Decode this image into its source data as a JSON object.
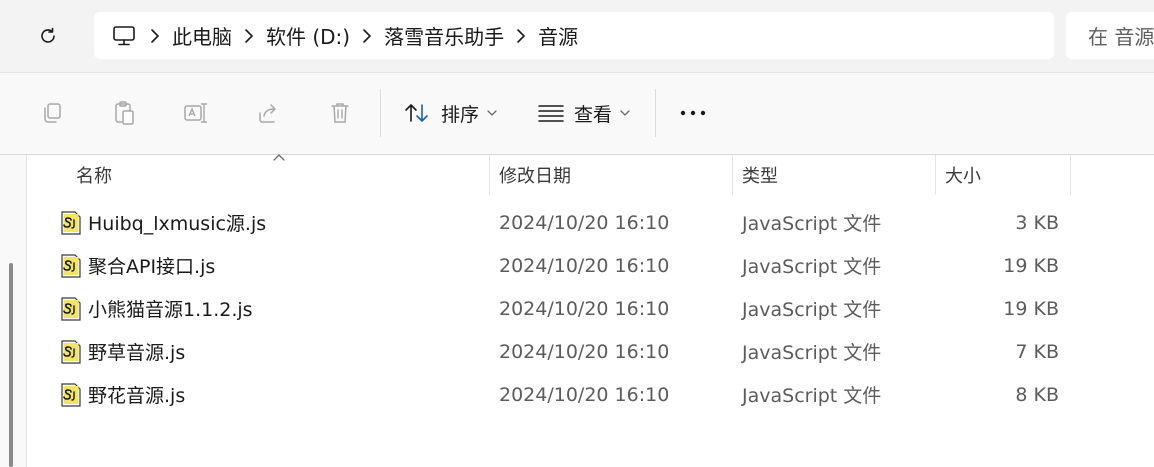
{
  "address": {
    "crumbs": [
      "此电脑",
      "软件 (D:)",
      "落雪音乐助手",
      "音源"
    ],
    "search_placeholder": "在 音源"
  },
  "toolbar": {
    "sort_label": "排序",
    "view_label": "查看"
  },
  "columns": {
    "name": "名称",
    "modified": "修改日期",
    "type": "类型",
    "size": "大小"
  },
  "files": [
    {
      "name": "Huibq_lxmusic源.js",
      "modified": "2024/10/20 16:10",
      "type": "JavaScript 文件",
      "size": "3 KB"
    },
    {
      "name": "聚合API接口.js",
      "modified": "2024/10/20 16:10",
      "type": "JavaScript 文件",
      "size": "19 KB"
    },
    {
      "name": "小熊猫音源1.1.2.js",
      "modified": "2024/10/20 16:10",
      "type": "JavaScript 文件",
      "size": "19 KB"
    },
    {
      "name": "野草音源.js",
      "modified": "2024/10/20 16:10",
      "type": "JavaScript 文件",
      "size": "7 KB"
    },
    {
      "name": "野花音源.js",
      "modified": "2024/10/20 16:10",
      "type": "JavaScript 文件",
      "size": "8 KB"
    }
  ],
  "icons": {
    "refresh": "refresh-icon",
    "computer": "computer-icon",
    "copy": "copy-icon",
    "paste": "paste-icon",
    "rename": "rename-icon",
    "share": "share-icon",
    "delete": "delete-icon",
    "sort": "sort-icon",
    "view": "view-icon",
    "more": "more-icon",
    "file": "js-file-icon"
  },
  "colors": {
    "toolbar_bg": "#f9f9f9",
    "address_bg": "#f3f3f3",
    "disabled_icon": "#a8a8a8"
  }
}
